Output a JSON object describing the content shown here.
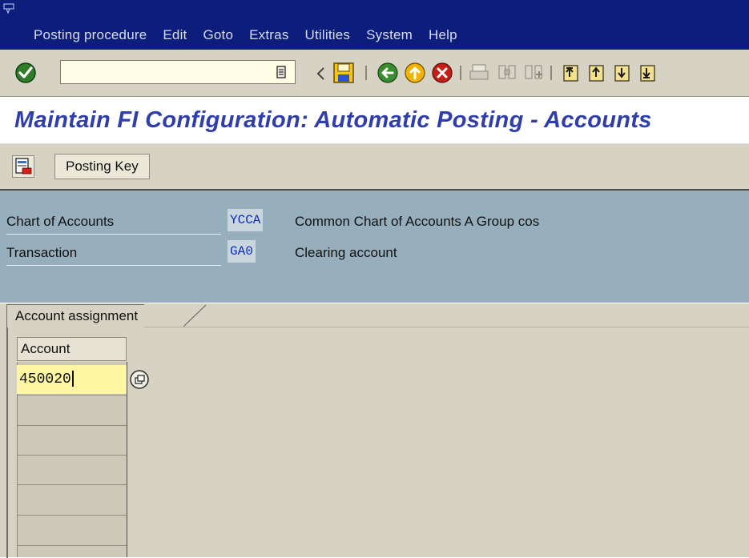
{
  "menu": {
    "items": [
      {
        "label": "Posting procedure"
      },
      {
        "label": "Edit"
      },
      {
        "label": "Goto"
      },
      {
        "label": "Extras"
      },
      {
        "label": "Utilities"
      },
      {
        "label": "System"
      },
      {
        "label": "Help"
      }
    ]
  },
  "toolbar": {
    "command_field_value": "",
    "icons": [
      "enter-icon",
      "back-icon",
      "save-icon",
      "green-back-icon",
      "exit-icon",
      "cancel-icon",
      "print-icon",
      "find-icon",
      "find-next-icon",
      "first-page-icon",
      "previous-page-icon",
      "next-page-icon",
      "last-page-icon"
    ]
  },
  "title": "Maintain FI Configuration: Automatic Posting - Accounts",
  "app_toolbar": {
    "posting_key_label": "Posting Key"
  },
  "header": {
    "chart_of_accounts": {
      "label": "Chart of Accounts",
      "code": "YCCA",
      "description": "Common Chart of Accounts A Group cos"
    },
    "transaction": {
      "label": "Transaction",
      "code": "GA0",
      "description": "Clearing account"
    }
  },
  "tab": {
    "label": "Account assignment"
  },
  "table": {
    "column_header": "Account",
    "rows": [
      "450020",
      "",
      "",
      "",
      "",
      "",
      ""
    ]
  },
  "colors": {
    "menu_bar": "#0c1d7c",
    "title_text": "#2f3ea8",
    "header_area": "#97aebd",
    "code_text": "#0d2eb5",
    "input_highlight": "#fff6a4"
  }
}
